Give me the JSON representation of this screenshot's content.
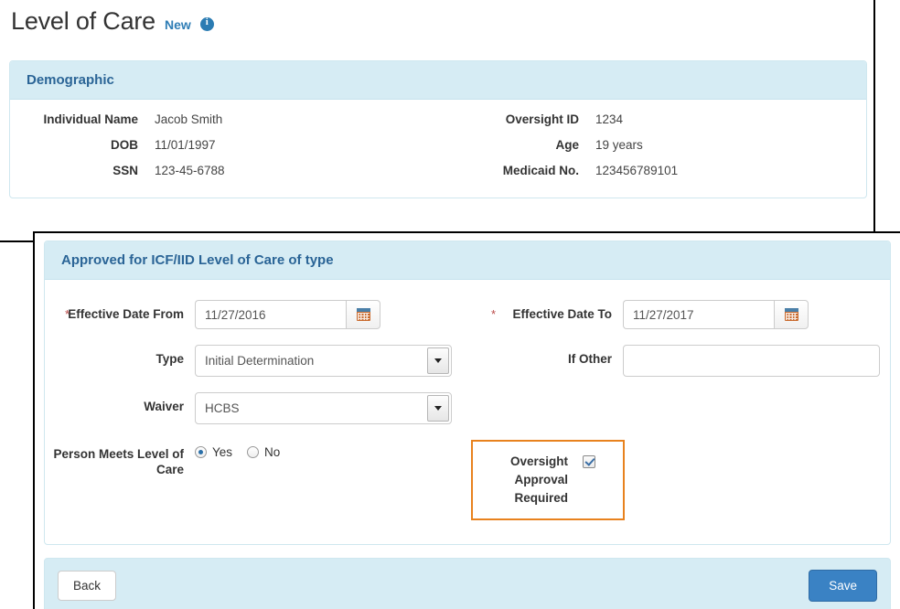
{
  "page": {
    "title": "Level of Care",
    "status_badge": "New",
    "info_icon": "info-circle-icon"
  },
  "demographic": {
    "heading": "Demographic",
    "rows": [
      {
        "left_label": "Individual Name",
        "left_value": "Jacob Smith",
        "right_label": "Oversight ID",
        "right_value": "1234"
      },
      {
        "left_label": "DOB",
        "left_value": "11/01/1997",
        "right_label": "Age",
        "right_value": "19 years"
      },
      {
        "left_label": "SSN",
        "left_value": "123-45-6788",
        "right_label": "Medicaid No.",
        "right_value": "123456789101"
      }
    ]
  },
  "form_panel": {
    "heading": "Approved for ICF/IID Level of Care of type",
    "required_marker": "*",
    "effective_date_from": {
      "label": "Effective Date From",
      "value": "11/27/2016",
      "placeholder": "",
      "calendar_icon": "calendar-icon"
    },
    "effective_date_to": {
      "label": "Effective Date To",
      "value": "11/27/2017",
      "placeholder": "",
      "calendar_icon": "calendar-icon"
    },
    "type": {
      "label": "Type",
      "value": "Initial Determination"
    },
    "if_other": {
      "label": "If Other",
      "value": "",
      "placeholder": ""
    },
    "waiver": {
      "label": "Waiver",
      "value": "HCBS"
    },
    "person_meets_level_of_care": {
      "label": "Person Meets Level of Care",
      "options": [
        {
          "label": "Yes",
          "selected": true
        },
        {
          "label": "No",
          "selected": false
        }
      ]
    },
    "oversight_approval_required": {
      "label": "Oversight Approval Required",
      "checked": true,
      "highlight_color": "#e8821e"
    }
  },
  "footer": {
    "back_label": "Back",
    "save_label": "Save"
  },
  "colors": {
    "panel_header_bg": "#d6ecf4",
    "panel_header_text": "#2a6496",
    "accent_blue": "#3a82c4",
    "highlight_orange": "#e8821e",
    "required_red": "#b94a48"
  }
}
